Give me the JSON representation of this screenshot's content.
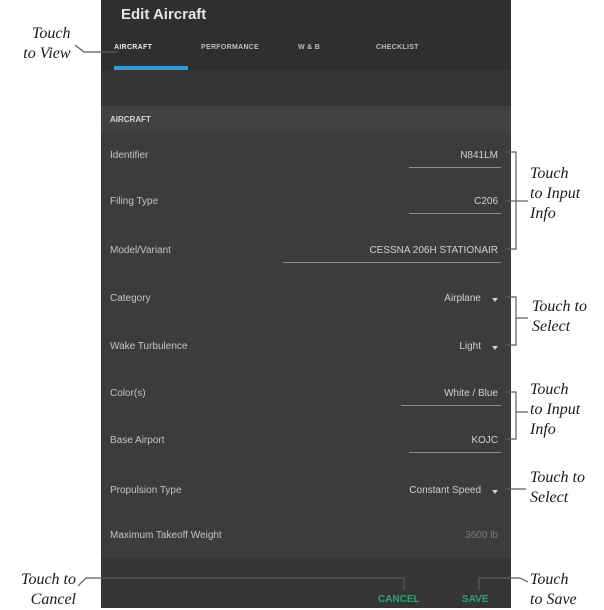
{
  "header": {
    "title": "Edit Aircraft"
  },
  "tabs": [
    {
      "label": "AIRCRAFT",
      "active": true
    },
    {
      "label": "PERFORMANCE",
      "active": false
    },
    {
      "label": "W & B",
      "active": false
    },
    {
      "label": "CHECKLIST",
      "active": false
    }
  ],
  "section": {
    "label": "AIRCRAFT"
  },
  "rows": [
    {
      "label": "Identifier",
      "value": "N841LM"
    },
    {
      "label": "Filing Type",
      "value": "C206"
    },
    {
      "label": "Model/Variant",
      "value": "CESSNA 206H STATIONAIR"
    },
    {
      "label": "Category",
      "value": "Airplane"
    },
    {
      "label": "Wake Turbulence",
      "value": "Light"
    },
    {
      "label": "Color(s)",
      "value": "White / Blue"
    },
    {
      "label": "Base Airport",
      "value": "KOJC"
    },
    {
      "label": "Propulsion Type",
      "value": "Constant Speed"
    },
    {
      "label": "Maximum Takeoff Weight",
      "value": "3600 lb"
    }
  ],
  "footer": {
    "cancel": "CANCEL",
    "save": "SAVE"
  },
  "callouts": {
    "view": [
      "Touch",
      "to View"
    ],
    "input1": [
      "Touch",
      "to Input",
      "Info"
    ],
    "select1": [
      "Touch to",
      "Select"
    ],
    "input2": [
      "Touch",
      "to Input",
      "Info"
    ],
    "select2": [
      "Touch to",
      "Select"
    ],
    "cancel": [
      "Touch to",
      "Cancel"
    ],
    "save": [
      "Touch",
      "to Save"
    ]
  },
  "colors": {
    "accent": "#2f9bd9",
    "action": "#2fa36b",
    "background": "#3c3c3c"
  }
}
